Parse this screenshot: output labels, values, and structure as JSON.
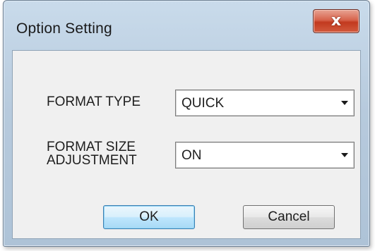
{
  "dialog": {
    "title": "Option Setting",
    "close_glyph": "x"
  },
  "fields": {
    "format_type": {
      "label": "FORMAT TYPE",
      "value": "QUICK"
    },
    "format_size": {
      "label_line1": "FORMAT SIZE",
      "label_line2": "ADJUSTMENT",
      "value": "ON"
    }
  },
  "buttons": {
    "ok_label": "OK",
    "cancel_label": "Cancel"
  },
  "icons": {
    "close": "close-icon",
    "dropdown": "chevron-down-icon"
  }
}
